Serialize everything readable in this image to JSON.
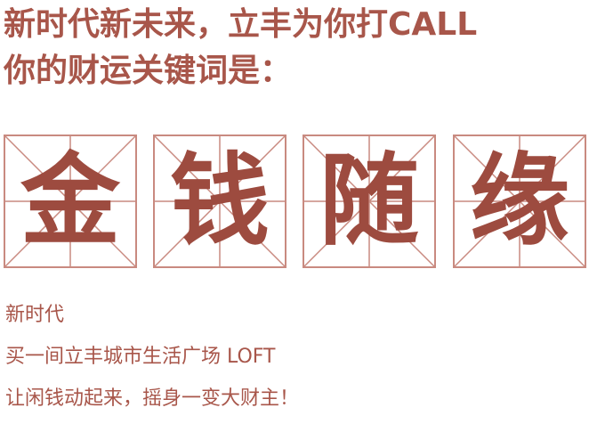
{
  "colors": {
    "primary": "#a8564a",
    "character": "#9d4b3f",
    "grid_line": "#c98a80",
    "background": "#ffffff"
  },
  "header": {
    "line1": "新时代新未来，立丰为你打CALL",
    "line2": "你的财运关键词是："
  },
  "keyword": {
    "characters": [
      "金",
      "钱",
      "随",
      "缘"
    ]
  },
  "body": {
    "lines": [
      "新时代",
      "买一间立丰城市生活广场 LOFT",
      "让闲钱动起来，摇身一变大财主！"
    ]
  }
}
